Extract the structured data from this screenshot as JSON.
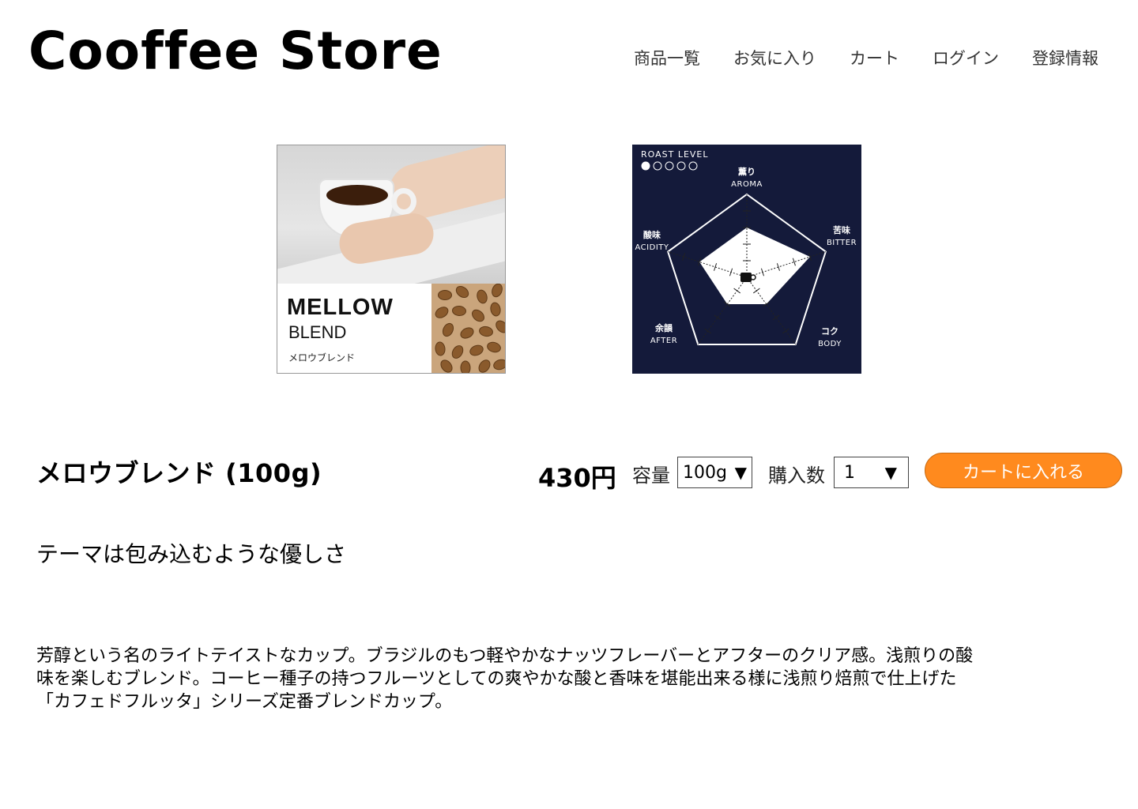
{
  "header": {
    "logo": "Cooffee Store",
    "nav": [
      "商品一覧",
      "お気に入り",
      "カート",
      "ログイン",
      "登録情報"
    ]
  },
  "product_image": {
    "title": "MELLOW",
    "subtitle": "BLEND",
    "jp_name": "メロウブレンド"
  },
  "flavor_chart": {
    "roast_label": "ROAST LEVEL",
    "roast_level": 1,
    "roast_max": 5,
    "axes": [
      {
        "jp": "薫り",
        "en": "AROMA"
      },
      {
        "jp": "苦味",
        "en": "BITTER"
      },
      {
        "jp": "コク",
        "en": "BODY"
      },
      {
        "jp": "余韻",
        "en": "AFTER"
      },
      {
        "jp": "酸味",
        "en": "ACIDITY"
      }
    ],
    "values": [
      3,
      4,
      2,
      2,
      3
    ],
    "scale_max": 5,
    "center_label": "COFFEE",
    "colors": {
      "background": "#141a3a",
      "fill": "#ffffff",
      "line": "#ffffff"
    }
  },
  "product": {
    "name": "メロウブレンド (100g)",
    "price": "430円",
    "capacity_label": "容量",
    "capacity_value": "100g",
    "quantity_label": "購入数",
    "quantity_value": "1",
    "cart_button": "カートに入れる",
    "theme": "テーマは包み込むような優しさ",
    "description": "芳醇という名のライトテイストなカップ。ブラジルのもつ軽やかなナッツフレーバーとアフターのクリア感。浅煎りの酸味を楽しむブレンド。コーヒー種子の持つフルーツとしての爽やかな酸と香味を堪能出来る様に浅煎り焙煎で仕上げた「カフェドフルッタ」シリーズ定番ブレンドカップ。"
  },
  "colors": {
    "accent": "#ff8a1e"
  }
}
